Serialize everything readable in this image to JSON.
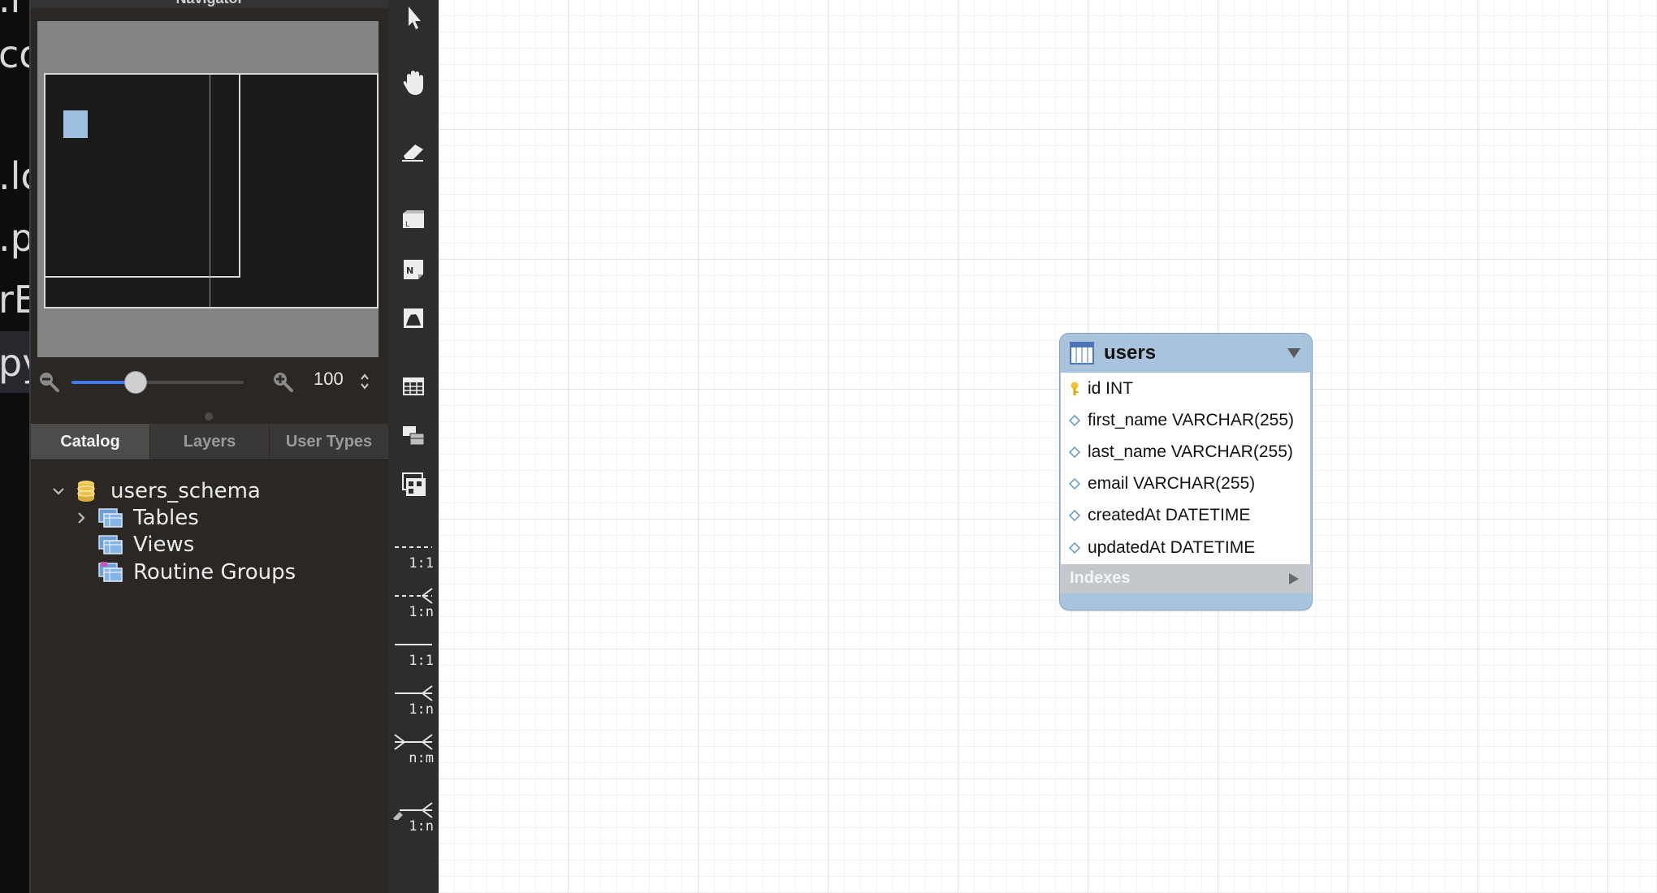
{
  "navigator": {
    "title": "Navigator",
    "zoom": {
      "value": "100",
      "slider_fraction": 0.37
    }
  },
  "tabs": [
    {
      "label": "Catalog",
      "active": true
    },
    {
      "label": "Layers",
      "active": false
    },
    {
      "label": "User Types",
      "active": false
    }
  ],
  "catalog": {
    "schema": "users_schema",
    "children": [
      "Tables",
      "Views",
      "Routine Groups"
    ]
  },
  "toolbar": {
    "tools": [
      "pointer-icon",
      "hand-icon",
      "eraser-icon",
      "layer-icon",
      "note-icon",
      "image-icon",
      "table-icon",
      "view-icon",
      "routine-group-icon"
    ],
    "relationships": [
      {
        "label": "1:1",
        "style": "dashed"
      },
      {
        "label": "1:n",
        "style": "dashed"
      },
      {
        "label": "1:1",
        "style": "solid"
      },
      {
        "label": "1:n",
        "style": "solid"
      },
      {
        "label": "n:m",
        "style": "solid"
      },
      {
        "label": "1:n",
        "style": "existing-columns"
      }
    ]
  },
  "diagram": {
    "table": {
      "name": "users",
      "columns": [
        {
          "text": "id INT",
          "key": "primary"
        },
        {
          "text": "first_name VARCHAR(255)",
          "key": "none"
        },
        {
          "text": "last_name VARCHAR(255)",
          "key": "none"
        },
        {
          "text": "email VARCHAR(255)",
          "key": "none"
        },
        {
          "text": "createdAt DATETIME",
          "key": "none"
        },
        {
          "text": "updatedAt DATETIME",
          "key": "none"
        }
      ],
      "indexes_label": "Indexes"
    }
  },
  "left_strip": {
    "fragments": [
      ".r",
      "co",
      ".lc",
      ".py",
      "rE",
      "py"
    ]
  },
  "colors": {
    "accent": "#3c7be6",
    "table_header": "#a9c3dc",
    "panel_bg": "#2a2725"
  }
}
